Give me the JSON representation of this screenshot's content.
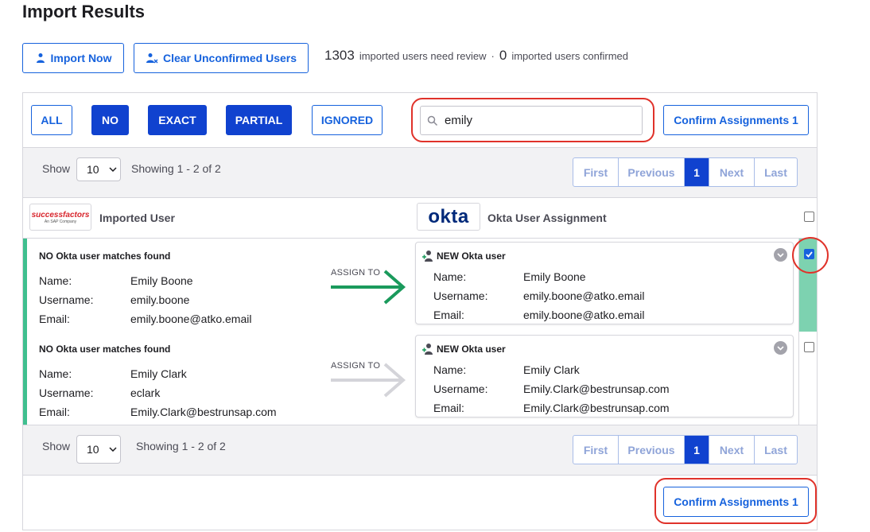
{
  "page": {
    "title": "Import Results"
  },
  "toolbar": {
    "import_now": "Import Now",
    "clear_unconfirmed": "Clear Unconfirmed Users"
  },
  "summary": {
    "review_count": "1303",
    "review_text": "imported users need review",
    "separator": "·",
    "confirmed_count": "0",
    "confirmed_text": "imported users confirmed"
  },
  "filters": {
    "all": "ALL",
    "no": "NO",
    "exact": "EXACT",
    "partial": "PARTIAL",
    "ignored": "IGNORED"
  },
  "search": {
    "value": "emily"
  },
  "confirm_button": {
    "label": "Confirm Assignments 1"
  },
  "pagination_top": {
    "show_label": "Show",
    "page_size": "10",
    "showing": "Showing 1 - 2 of 2",
    "first": "First",
    "previous": "Previous",
    "current": "1",
    "next": "Next",
    "last": "Last"
  },
  "pagination_bottom": {
    "show_label": "Show",
    "page_size": "10",
    "showing": "Showing 1 - 2 of 2",
    "first": "First",
    "previous": "Previous",
    "current": "1",
    "next": "Next",
    "last": "Last"
  },
  "columns": {
    "imported_user": "Imported User",
    "okta_assignment": "Okta User Assignment",
    "sf_logo_text": "successfactors",
    "sf_logo_sub": "An SAP Company",
    "okta_logo_text": "okta"
  },
  "rows": [
    {
      "match_status": "NO Okta user matches found",
      "name_label": "Name:",
      "name": "Emily Boone",
      "username_label": "Username:",
      "username": "emily.boone",
      "email_label": "Email:",
      "email": "emily.boone@atko.email",
      "assign_to": "ASSIGN TO",
      "arrow_color": "#1a9a5c",
      "checked": true,
      "card": {
        "title": "NEW Okta user",
        "name_label": "Name:",
        "name": "Emily Boone",
        "username_label": "Username:",
        "username": "emily.boone@atko.email",
        "email_label": "Email:",
        "email": "emily.boone@atko.email"
      }
    },
    {
      "match_status": "NO Okta user matches found",
      "name_label": "Name:",
      "name": "Emily Clark",
      "username_label": "Username:",
      "username": "eclark",
      "email_label": "Email:",
      "email": "Emily.Clark@bestrunsap.com",
      "assign_to": "ASSIGN TO",
      "arrow_color": "#d4d4d9",
      "checked": false,
      "card": {
        "title": "NEW Okta user",
        "name_label": "Name:",
        "name": "Emily Clark",
        "username_label": "Username:",
        "username": "Emily.Clark@bestrunsap.com",
        "email_label": "Email:",
        "email": "Emily.Clark@bestrunsap.com"
      }
    }
  ],
  "colors": {
    "primary": "#1662dd",
    "primary_solid": "#1042cf",
    "match_green": "#3fbf8f",
    "highlight_red": "#e0322a"
  }
}
